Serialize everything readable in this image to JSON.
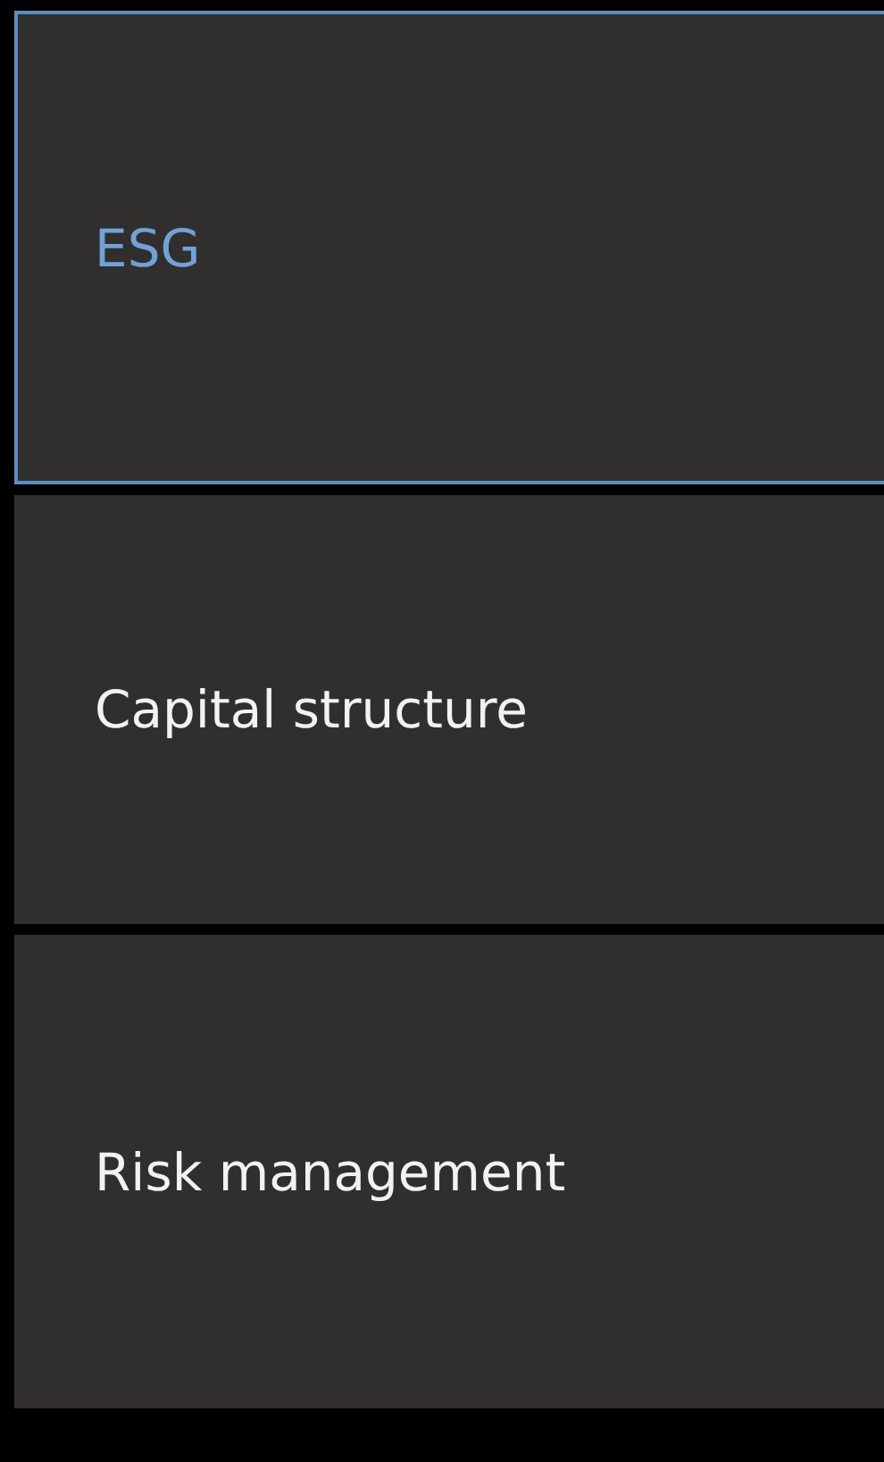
{
  "options": [
    {
      "label": "ESG",
      "selected": true
    },
    {
      "label": "Capital structure",
      "selected": false
    },
    {
      "label": "Risk management",
      "selected": false
    }
  ]
}
